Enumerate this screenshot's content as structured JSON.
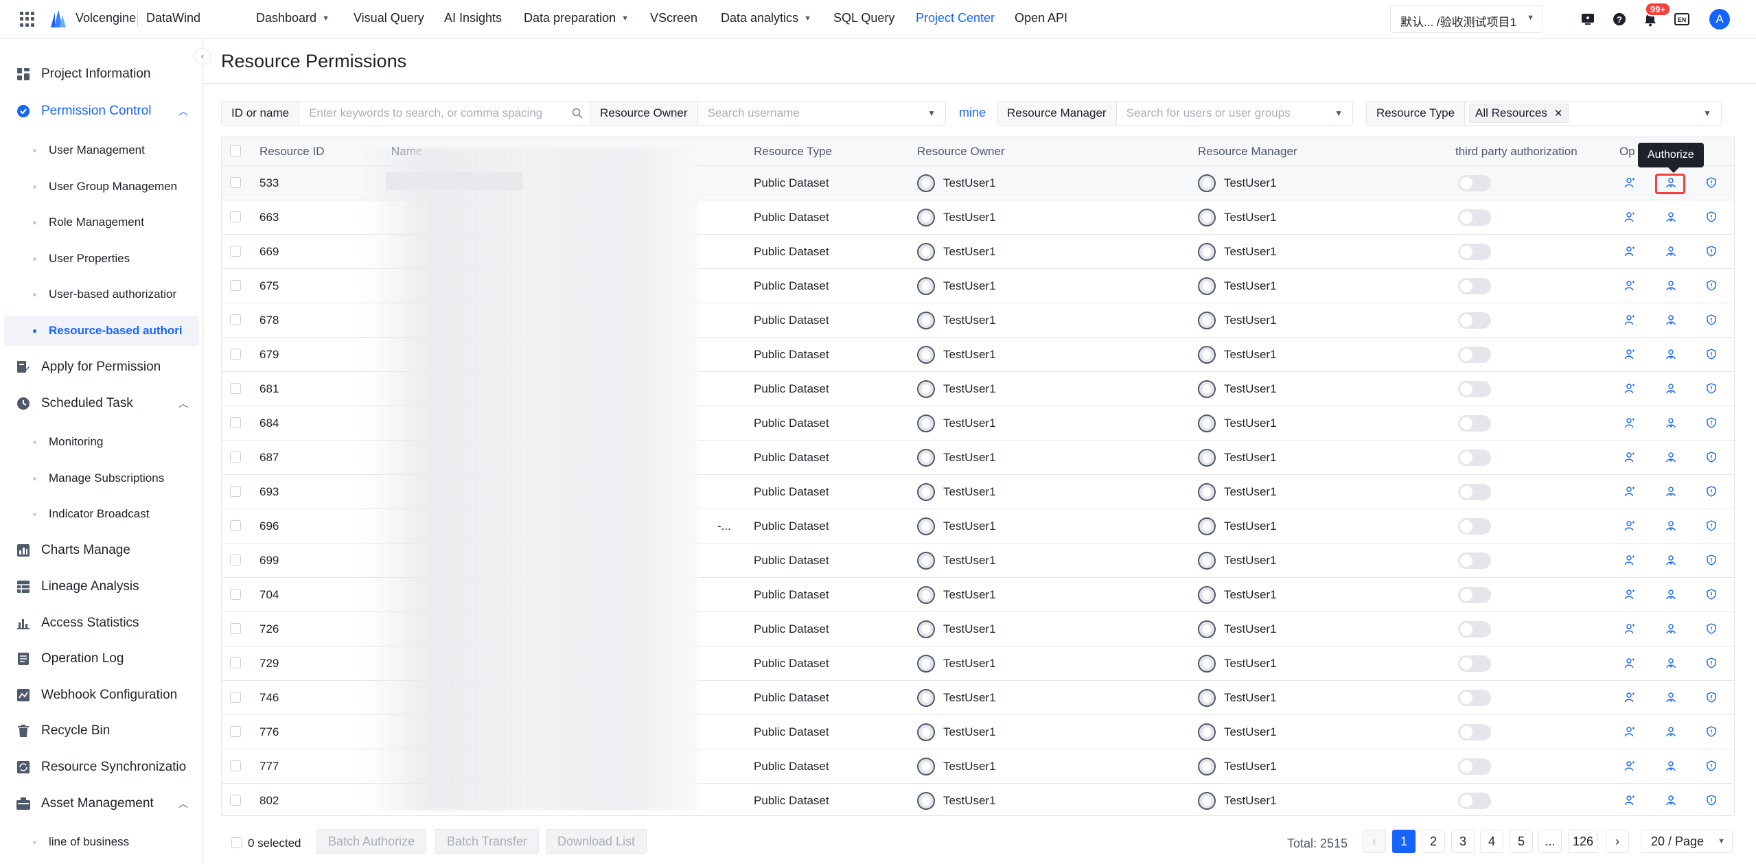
{
  "topbar": {
    "brand": "Volcengine",
    "product": "DataWind",
    "nav": [
      {
        "label": "Dashboard",
        "dropdown": true
      },
      {
        "label": "Visual Query",
        "dropdown": false
      },
      {
        "label": "AI Insights",
        "dropdown": false
      },
      {
        "label": "Data preparation",
        "dropdown": true
      },
      {
        "label": "VScreen",
        "dropdown": false
      },
      {
        "label": "Data analytics",
        "dropdown": true
      },
      {
        "label": "SQL Query",
        "dropdown": false
      },
      {
        "label": "Project Center",
        "dropdown": false,
        "active": true
      },
      {
        "label": "Open API",
        "dropdown": false
      }
    ],
    "project_selector": "默认... /验收测试项目1",
    "notification_count": "99+",
    "avatar_letter": "A"
  },
  "sidebar": {
    "items": [
      {
        "label": "Project Information",
        "icon": "grid-icon"
      },
      {
        "label": "Permission Control",
        "icon": "shield-check-icon",
        "open": true
      },
      {
        "label": "User Management",
        "sub": true
      },
      {
        "label": "User Group Managemen",
        "sub": true
      },
      {
        "label": "Role Management",
        "sub": true
      },
      {
        "label": "User Properties",
        "sub": true
      },
      {
        "label": "User-based authorizatior",
        "sub": true
      },
      {
        "label": "Resource-based authori",
        "sub": true,
        "active": true
      },
      {
        "label": "Apply for Permission",
        "icon": "edit-doc-icon"
      },
      {
        "label": "Scheduled Task",
        "icon": "clock-icon",
        "expanded": true
      },
      {
        "label": "Monitoring",
        "sub": true
      },
      {
        "label": "Manage Subscriptions",
        "sub": true
      },
      {
        "label": "Indicator Broadcast",
        "sub": true
      },
      {
        "label": "Charts Manage",
        "icon": "bar-chart-icon"
      },
      {
        "label": "Lineage Analysis",
        "icon": "table-icon"
      },
      {
        "label": "Access Statistics",
        "icon": "stats-icon"
      },
      {
        "label": "Operation Log",
        "icon": "log-icon"
      },
      {
        "label": "Webhook Configuration",
        "icon": "webhook-icon"
      },
      {
        "label": "Recycle Bin",
        "icon": "trash-icon"
      },
      {
        "label": "Resource Synchronizatio",
        "icon": "sync-icon"
      },
      {
        "label": "Asset Management",
        "icon": "asset-icon",
        "expanded": true
      },
      {
        "label": "line of business",
        "sub": true
      }
    ]
  },
  "page": {
    "title": "Resource Permissions"
  },
  "filters": {
    "id_label": "ID or name",
    "id_placeholder": "Enter keywords to search, or comma spacing",
    "owner_label": "Resource Owner",
    "owner_placeholder": "Search username",
    "mine": "mine",
    "manager_label": "Resource Manager",
    "manager_placeholder": "Search for users or user groups",
    "type_label": "Resource Type",
    "type_tag": "All Resources"
  },
  "table": {
    "headers": {
      "id": "Resource ID",
      "name": "Name",
      "type": "Resource Type",
      "owner": "Resource Owner",
      "manager": "Resource Manager",
      "third_party": "third party authorization",
      "operation": "Op"
    },
    "rows": [
      {
        "id": "533",
        "type": "Public Dataset",
        "owner": "TestUser1",
        "manager": "TestUser1"
      },
      {
        "id": "663",
        "type": "Public Dataset",
        "owner": "TestUser1",
        "manager": "TestUser1"
      },
      {
        "id": "669",
        "type": "Public Dataset",
        "owner": "TestUser1",
        "manager": "TestUser1"
      },
      {
        "id": "675",
        "type": "Public Dataset",
        "owner": "TestUser1",
        "manager": "TestUser1"
      },
      {
        "id": "678",
        "type": "Public Dataset",
        "owner": "TestUser1",
        "manager": "TestUser1"
      },
      {
        "id": "679",
        "type": "Public Dataset",
        "owner": "TestUser1",
        "manager": "TestUser1"
      },
      {
        "id": "681",
        "type": "Public Dataset",
        "owner": "TestUser1",
        "manager": "TestUser1"
      },
      {
        "id": "684",
        "type": "Public Dataset",
        "owner": "TestUser1",
        "manager": "TestUser1"
      },
      {
        "id": "687",
        "type": "Public Dataset",
        "owner": "TestUser1",
        "manager": "TestUser1"
      },
      {
        "id": "693",
        "type": "Public Dataset",
        "owner": "TestUser1",
        "manager": "TestUser1"
      },
      {
        "id": "696",
        "type": "Public Dataset",
        "owner": "TestUser1",
        "manager": "TestUser1",
        "name_tail": "-..."
      },
      {
        "id": "699",
        "type": "Public Dataset",
        "owner": "TestUser1",
        "manager": "TestUser1"
      },
      {
        "id": "704",
        "type": "Public Dataset",
        "owner": "TestUser1",
        "manager": "TestUser1"
      },
      {
        "id": "726",
        "type": "Public Dataset",
        "owner": "TestUser1",
        "manager": "TestUser1"
      },
      {
        "id": "729",
        "type": "Public Dataset",
        "owner": "TestUser1",
        "manager": "TestUser1"
      },
      {
        "id": "746",
        "type": "Public Dataset",
        "owner": "TestUser1",
        "manager": "TestUser1"
      },
      {
        "id": "776",
        "type": "Public Dataset",
        "owner": "TestUser1",
        "manager": "TestUser1"
      },
      {
        "id": "777",
        "type": "Public Dataset",
        "owner": "TestUser1",
        "manager": "TestUser1"
      },
      {
        "id": "802",
        "type": "Public Dataset",
        "owner": "TestUser1",
        "manager": "TestUser1"
      }
    ],
    "tooltip": "Authorize"
  },
  "footer": {
    "selected": "0 selected",
    "batch_authorize": "Batch Authorize",
    "batch_transfer": "Batch Transfer",
    "download_list": "Download List",
    "total": "Total: 2515",
    "pages": [
      "1",
      "2",
      "3",
      "4",
      "5",
      "...",
      "126"
    ],
    "current_page": "1",
    "page_size": "20  / Page"
  },
  "colors": {
    "accent": "#1664ff",
    "badge": "#f53f3f",
    "highlight_box": "#f53f3f"
  }
}
